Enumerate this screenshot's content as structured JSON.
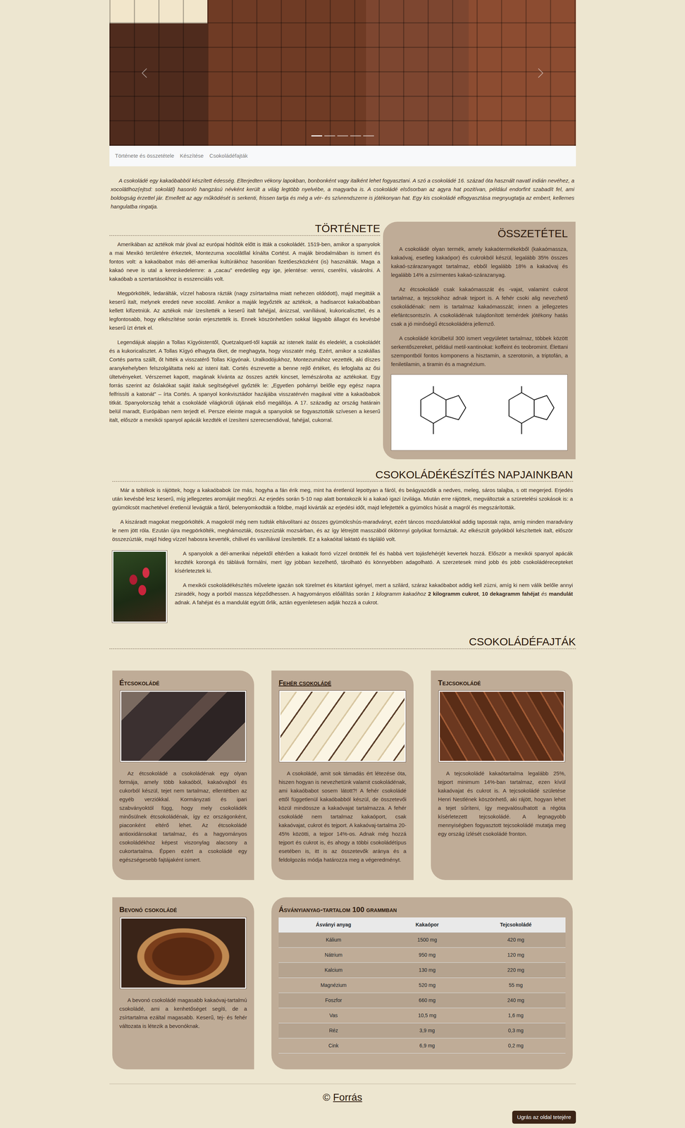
{
  "carousel": {
    "slides": [
      {
        "selected": true
      },
      {
        "selected": false
      },
      {
        "selected": false
      },
      {
        "selected": false
      },
      {
        "selected": false
      }
    ]
  },
  "nav": {
    "links": [
      {
        "label": "Története és összetétele"
      },
      {
        "label": "Készítése"
      },
      {
        "label": "Csokoládéfajták"
      }
    ]
  },
  "intro": "A csokoládé egy kakaóbabból készített édesség. Elterjedten vékony lapokban, bonbonként vagy italként lehet fogyasztani. A szó a csokoládé 16. század óta használt navatl indián nevéhez, a xocolātlhoz(ejtsd: sokolátl) hasonló hangzású névként került a világ legtöbb nyelvébe, a magyarba is. A csokoládé elsősorban az agyra hat pozitívan, például endorfint szabadít fel, ami boldogság érzettel jár. Emellett az agy működését is serkenti, frissen tartja és még a vér- és szívrendszerre is jótékonyan hat. Egy kis csokoládé elfogyasztása megnyugtatja az embert, kellemes hangulatba ringatja.",
  "history": {
    "title": "TÖRTÉNETE",
    "paragraphs": [
      "Amerikában az aztékok már jóval az európai hódítók előtt is itták a csokoládét. 1519-ben, amikor a spanyolok a mai Mexikó területére érkeztek, Montezuma xocolātllal kínálta Cortést. A maják birodalmában is ismert és fontos volt: a kakaóbabot más dél-amerikai kultúrákhoz hasonlóan fizetőeszközként (is) használták. Maga a kakaó neve is utal a kereskedelemre: a „cacau” eredetileg egy ige, jelentése: venni, cserélni, vásárolni. A kakaóbab a szertartásokhoz is esszenciális volt.",
      "Megpörkölték, ledarálták, vízzel habosra rázták (nagy zsírtartalma miatt nehezen oldódott), majd megitták a keserű italt, melynek eredeti neve xocolātl. Amikor a maják legyőzték az aztékok, a hadisarcot kakaóbabban kellett kifizetniük. Az aztékok már ízesítették a keserű italt fahéjjal, ánizzsal, vaníliával, kukoricaliszttel, és a legfontosabb, hogy elkészítése során erjesztették is. Ennek köszönhetően sokkal lágyabb állagot és kevésbé keserű ízt értek el.",
      "Legendájuk alapján a Tollas Kígyóistentől, Quetzalquetl-től kapták az istenek italát és eledelét, a csokoládét és a kukoricalisztet. A Tollas Kígyó elhagyta őket, de meghagyta, hogy visszatér még. Ezért, amikor a szakállas Cortés partra szállt, őt hitték a visszatérő Tollas Kígyónak. Uralkodójukhoz, Montezumához vezették, aki díszes aranykehelyben felszolgáltatta neki az isteni italt. Cortés észrevette a benne rejlő értéket, és lefoglalta az ősi ültetvényeket. Vérszemet kapott, magának kívánta az összes azték kincset, lemészárolta az aztékokat. Egy forrás szerint az őslakókat saját italuk segítségével győzték le: „Egyetlen pohárnyi belőle egy egész napra felfrissíti a katonát” – írta Cortés. A spanyol konkvisztádor hazájába visszatérvén magával vitte a kakaóbabok titkát. Spanyolország tehát a csokoládé világkörüli útjának első megállója. A 17. századig az ország határain belül maradt, Európában nem terjedt el. Persze eleinte maguk a spanyolok se fogyasztották szívesen a keserű italt, először a mexikói spanyol apácák kezdték el ízesíteni szerecsendióval, fahéjjal, cukorral."
    ]
  },
  "composition": {
    "title": "ÖSSZETÉTEL",
    "paragraphs": [
      "A csokoládé olyan termék, amely kakaótermékekből (kakaómassza, kakaóvaj, esetleg kakaópor) és cukrokból készül, legalább 35% összes kakaó-szárazanyagot tartalmaz, ebből legalább 18% a kakaóvaj és legalább 14% a zsírmentes kakaó-szárazanyag.",
      "Az étcsokoládé csak kakaómasszát és -vajat, valamint cukrot tartalmaz, a tejcsokihoz adnak tejport is. A fehér csoki alig nevezhető csokoládénak: nem is tartalmaz kakaómasszát; innen a jellegzetes elefántcsontszín. A csokoládénak tulajdonított temérdek jótékony hatás csak a jó minőségű étcsokoládéra jellemző.",
      "A csokoládé körülbelül 300 ismert vegyületet tartalmaz, többek között serkentőszereket, például metil-xantinokat: koffeint és teobromint. Élettani szempontból fontos komponens a hisztamin, a szerotonin, a triptofán, a feniletilamin, a tiramin és a magnézium."
    ]
  },
  "making": {
    "title": "CSOKOLÁDÉKÉSZÍTÉS NAPJAINKBAN",
    "paragraphs": [
      [
        {
          "kind": "plain",
          "text": "Már a toltékok is rájöttek, hogy a kakaóbabok íze más, hogyha a fán érik meg, mint ha éretlenül lepottyan a fáról, és beágyazódik a nedves, meleg, sáros talajba, s ott megerjed. Erjedés után kevésbé lesz keserű, míg jellegzetes aromáját megőrzi. Az erjedés során 5-10 nap alatt bontakozik ki a kakaó igazi ízvilága. Miután erre rájöttek, megváltoztak a szüretelési szokások is: a gyümölcsöt machetével éretlenül levágták a fáról, belenyomkodták a földbe, majd kivárták az erjedési időt, majd lefejtették a gyümölcs húsát a magról és megszárították."
        }
      ],
      [
        {
          "kind": "plain",
          "text": "A kiszáradt magokat megpörkölték. A magokról még nem tudták eltávolítani az összes gyümölcshús-maradványt, ezért táncos mozdulatokkal addig tapostak rajta, amíg minden maradvány le nem jött róla. Ezután újra megpörkölték, meghámozták, összezúzták mozsárban, és az így létrejött masszából öklömnyi golyókat formáztak. Az elkészült golyókból készítettek italt, először összezúzták, majd hideg vízzel habosra keverték, chilivel és vaníliával ízesítették. Ez a kakaóital laktató és tápláló volt."
        }
      ]
    ],
    "figure_paragraphs": [
      [
        {
          "kind": "plain",
          "text": "A spanyolok a dél-amerikai népektől eltérően a kakaót forró vízzel öntötték fel és habbá vert tojásfehérjét kevertek hozzá. Először a mexikói spanyol apácák kezdték korongá és táblává formálni, mert így jobban kezelhető, tárolható és könnyebben adagolható. A szerzetesek mind jobb és jobb csokoládérecepteket kísérleteztek ki."
        }
      ],
      [
        {
          "kind": "plain",
          "text": "A mexikói csokoládékészítés művelete igazán sok türelmet és kitartást igényel, mert a szilárd, száraz kakaóbabot addig kell zúzni, amíg ki nem válik belőle annyi zsiradék, hogy a porból massza képződhessen. A hagyományos előállítás során "
        },
        {
          "kind": "italic",
          "text": "1 kilogramm kakaóhoz"
        },
        {
          "kind": "plain",
          "text": " "
        },
        {
          "kind": "bold",
          "text": "2 kilogramm cukrot"
        },
        {
          "kind": "plain",
          "text": ", "
        },
        {
          "kind": "bold",
          "text": "10 dekagramm fahéjat"
        },
        {
          "kind": "italic",
          "text": " és "
        },
        {
          "kind": "bold",
          "text": "mandulát"
        },
        {
          "kind": "plain",
          "text": " adnak. A fahéjat és a mandulát együtt őrlik, aztán egyenletesen adják hozzá a cukrot."
        }
      ]
    ]
  },
  "varieties": {
    "title": "CSOKOLÁDÉFAJTÁK",
    "cards": [
      {
        "title": "Étcsokoládé",
        "underlined": false,
        "text": "Az étcsokoládé a csokoládénak egy olyan formája, amely több kakaóból, kakaóvajból és cukorból készül, tejet nem tartalmaz, ellentétben az egyéb verziókkal. Kormányzati és ipari szabványoktól függ, hogy mely csokoládék minősülnek étcsokoládénak, így ez országonként, piaconként eltérő lehet. Az étcsokoládé antioxidánsokat tartalmaz, és a hagyományos csokoládékhoz képest viszonylag alacsony a cukortartalma. Éppen ezért a csokoládé egy egészségesebb fajtájaként ismert."
      },
      {
        "title": "Fehér csokoládé",
        "underlined": true,
        "text": "A csokoládé, amit sok támadás ért létezése óta, hiszen hogyan is nevezhetünk valamit csokoládénak, ami kakaóbabot sosem látott?! A fehér csokoládé ettől függetlenül kakaóbabból készül, de összetevői közül mindössze a kakaóvajat tartalmazza. A fehér csokoládé nem tartalmaz kakaóport, csak kakaóvajat, cukrot és tejport. A kakaóvaj-tartalma 20-45% közötti, a tejpor 14%-os. Adnak még hozzá tejport és cukrot is, és ahogy a többi csokoládétípus esetében is, itt is az összetevők aránya és a feldolgozás módja határozza meg a végeredményt."
      },
      {
        "title": "Tejcsokoládé",
        "underlined": false,
        "text": "A tejcsokoládé kakaótartalma legalább 25%, tejport minimum 14%-ban tartalmaz, ezen kívül kakaóvajat és cukrot is. A tejcsokoládé születése Henri Nestlének köszönhető, aki rájött, hogyan lehet a tejet sűríteni, így megvalósulhatott a régóta kísérletezett tejcsokoládé. A legnagyobb mennyiségben fogyasztott tejcsokoládé mutatja meg egy ország ízlését csokoládé fronton."
      },
      {
        "title": "Bevonó csokoládé",
        "underlined": false,
        "text": "A bevonó csokoládé magasabb kakaóvaj-tartalmú csokoládé, ami a kenhetőséget segíti, de a zsírtartalma ezáltal magasabb. Keserű, tej- és fehér változata is létezik a bevonóknak."
      }
    ]
  },
  "minerals": {
    "title": "Ásványianyag-tartalom 100 grammban",
    "columns": [
      "Ásványi anyag",
      "Kakaópor",
      "Tejcsokoládé"
    ],
    "rows": [
      [
        "Kálium",
        "1500 mg",
        "420 mg"
      ],
      [
        "Nátrium",
        "950 mg",
        "120 mg"
      ],
      [
        "Kalcium",
        "130 mg",
        "220 mg"
      ],
      [
        "Magnézium",
        "520 mg",
        "55 mg"
      ],
      [
        "Foszfor",
        "660 mg",
        "240 mg"
      ],
      [
        "Vas",
        "10,5 mg",
        "1,6 mg"
      ],
      [
        "Réz",
        "3,9 mg",
        "0,3 mg"
      ],
      [
        "Cink",
        "6,9 mg",
        "0,2 mg"
      ]
    ]
  },
  "footer": {
    "copyright": "©",
    "link": "Forrás"
  },
  "top_button": "Ugrás az oldal tetejére"
}
